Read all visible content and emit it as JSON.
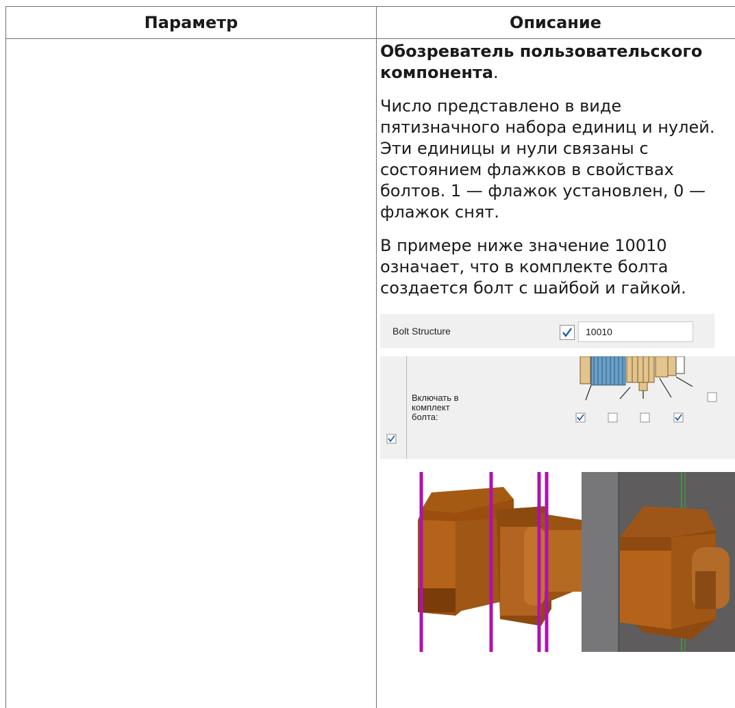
{
  "table": {
    "headers": [
      "Параметр",
      "Описание"
    ]
  },
  "description": {
    "title_bold": "Обозреватель пользовательского компонента",
    "title_suffix": ".",
    "paragraph1": "Число представлено в виде пятизначного набора единиц и нулей. Эти единицы и нули связаны с состоянием флажков в свойствах болтов. 1 — флажок установлен, 0 — флажок снят.",
    "paragraph2": "В примере ниже значение 10010 означает, что в комплекте болта создается болт с шайбой и гайкой."
  },
  "bolt_structure": {
    "label": "Bolt Structure",
    "checked": true,
    "value": "10010"
  },
  "include_panel": {
    "label": "Включать в комплект болта:",
    "row_checked": true,
    "component_checks": [
      true,
      false,
      false,
      true
    ],
    "extra_check": false
  },
  "colors": {
    "bolt_brown": "#b5621a",
    "magenta_line": "#b010b0",
    "plate_gray": "#6c6c6c",
    "checkbox_blue": "#1f5fa8"
  }
}
